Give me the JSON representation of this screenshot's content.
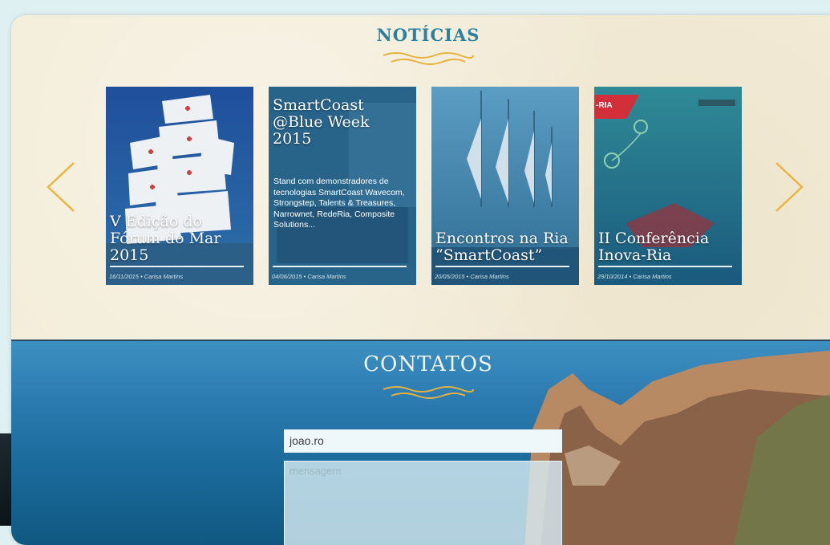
{
  "news": {
    "title": "NOTÍCIAS",
    "cards": [
      {
        "title": "V Edição do Fórum do Mar 2015",
        "meta": "16/11/2015 • Carisa Martins"
      },
      {
        "title": "SmartCoast @Blue Week 2015",
        "description": "Stand com demonstradores de tecnologias SmartCoast Wavecom, Strongstep, Talents & Treasures, Narrownet, RedeRia, Composite Solutions...",
        "meta": "04/06/2015 • Carisa Martins"
      },
      {
        "title": "Encontros na Ria “SmartCoast”",
        "meta": "20/05/2015 • Carisa Martins"
      },
      {
        "title": "II Conferência Inova-Ria",
        "meta": "29/10/2014 • Carisa Martins",
        "banner": "-RIA"
      }
    ]
  },
  "contacts": {
    "title": "CONTATOS",
    "email_value": "joao.ro",
    "message_placeholder": "mensagem"
  },
  "colors": {
    "accent_blue": "#2b7fa1",
    "wave_gold": "#e5b23e",
    "arrow_gold": "#e9b740",
    "parchment": "#f3ecd8"
  },
  "icons": {
    "prev": "chevron-left-icon",
    "next": "chevron-right-icon"
  }
}
